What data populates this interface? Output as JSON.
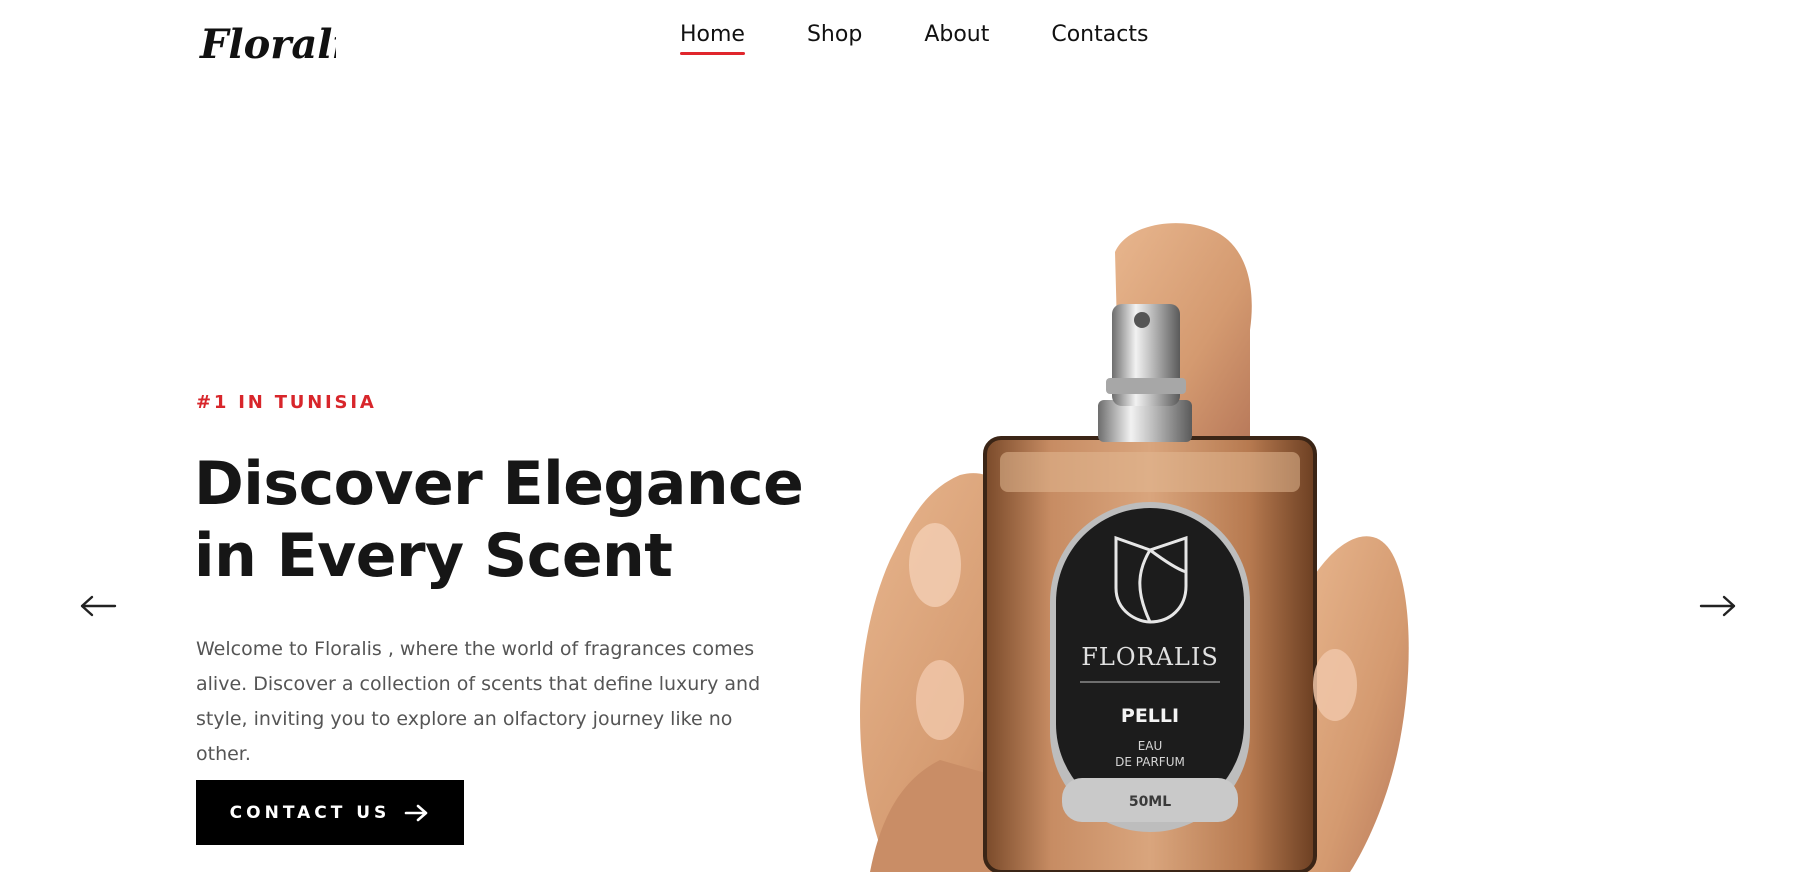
{
  "brand": {
    "logo_text": "Floralis"
  },
  "nav": {
    "items": [
      {
        "label": "Home",
        "active": true
      },
      {
        "label": "Shop",
        "active": false
      },
      {
        "label": "About",
        "active": false
      },
      {
        "label": "Contacts",
        "active": false
      }
    ]
  },
  "hero": {
    "eyebrow": "#1 IN TUNISIA",
    "title_line1": "Discover Elegance",
    "title_line2": "in Every Scent",
    "description": "Welcome to Floralis , where the world of fragrances comes alive. Discover a collection of scents that define luxury and style, inviting you to explore an olfactory journey like no other.",
    "cta_label": "CONTACT US",
    "cta_icon": "arrow-right-icon"
  },
  "slider": {
    "prev_icon": "arrow-left-icon",
    "next_icon": "arrow-right-icon"
  },
  "product_label": {
    "brand": "FLORALIS",
    "name": "PELLI",
    "type_line1": "EAU",
    "type_line2": "DE PARFUM",
    "volume": "50ML"
  },
  "colors": {
    "accent": "#d8262b",
    "button_bg": "#000000",
    "text_dark": "#161616",
    "text_muted": "#555555"
  }
}
